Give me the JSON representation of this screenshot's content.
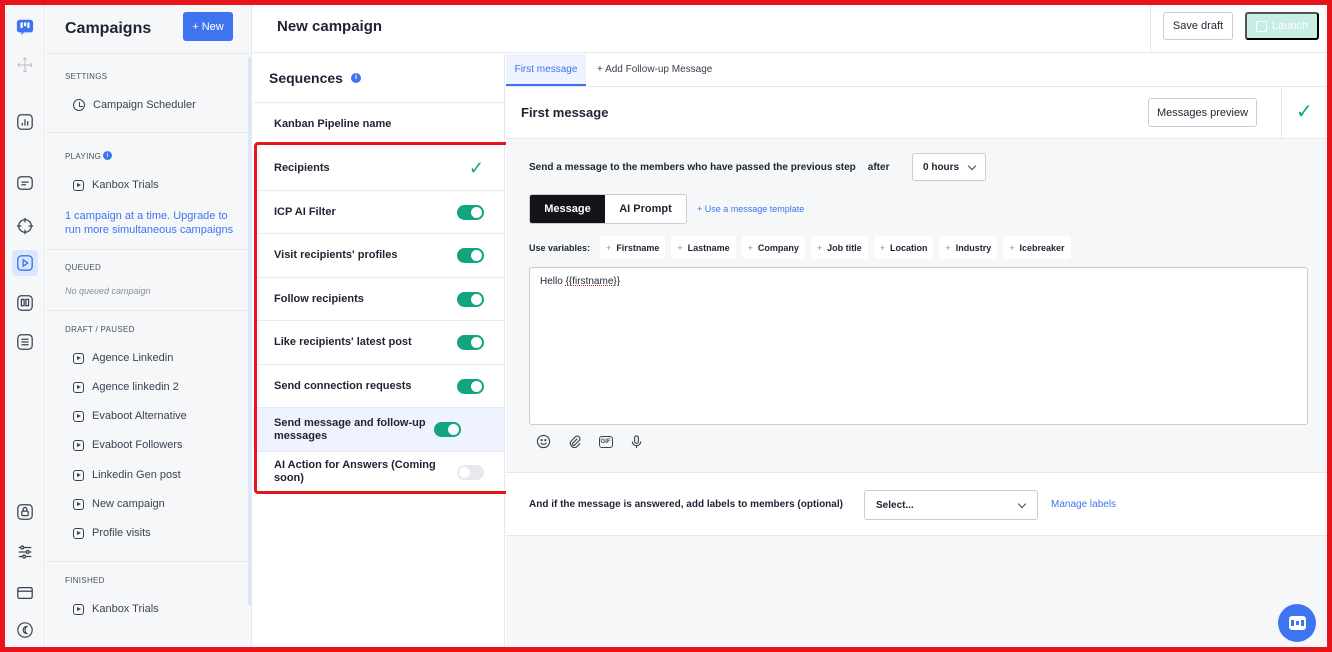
{
  "sidebar": {
    "title": "Campaigns",
    "new_button": "+ New",
    "sections": {
      "settings": "SETTINGS",
      "playing": "PLAYING",
      "queued": "QUEUED",
      "draft": "DRAFT / PAUSED",
      "finished": "FINISHED"
    },
    "scheduler": "Campaign Scheduler",
    "playing_items": [
      "Kanbox Trials"
    ],
    "upgrade_text": "1 campaign at a time. Upgrade to run more simultaneous campaigns",
    "queued_empty": "No queued campaign",
    "draft_items": [
      "Agence Linkedin",
      "Agence linkedin 2",
      "Evaboot Alternative",
      "Evaboot Followers",
      "Linkedin Gen post",
      "New campaign",
      "Profile visits"
    ],
    "finished_items": [
      "Kanbox Trials"
    ]
  },
  "header": {
    "title": "New campaign",
    "save_draft": "Save draft",
    "launch": "Launch"
  },
  "sequences": {
    "title": "Sequences",
    "pipeline": "Kanban Pipeline name",
    "rows": [
      {
        "label": "Recipients",
        "state": "check"
      },
      {
        "label": "ICP AI Filter",
        "state": "on"
      },
      {
        "label": "Visit recipients' profiles",
        "state": "on"
      },
      {
        "label": "Follow recipients",
        "state": "on"
      },
      {
        "label": "Like recipients' latest post",
        "state": "on"
      },
      {
        "label": "Send connection requests",
        "state": "on"
      },
      {
        "label": "Send message and follow-up messages",
        "state": "on",
        "selected": true
      },
      {
        "label": "AI Action for Answers (Coming soon)",
        "state": "off"
      }
    ]
  },
  "tabs": {
    "first": "First message",
    "add": "+ Add Follow-up Message"
  },
  "message": {
    "title": "First message",
    "preview_button": "Messages preview",
    "send_text": "Send a message to the members who have passed the previous step",
    "after": "after",
    "delay": "0 hours",
    "mode_message": "Message",
    "mode_ai": "AI Prompt",
    "template_link": "+ Use a message template",
    "variables_label": "Use variables:",
    "variables": [
      "Firstname",
      "Lastname",
      "Company",
      "Job title",
      "Location",
      "Industry",
      "Icebreaker"
    ],
    "body_prefix": "Hello ",
    "body_var": "{{firstname}}",
    "labels_text": "And if the message is answered, add labels to members (optional)",
    "labels_select": "Select...",
    "manage_labels": "Manage labels"
  },
  "colors": {
    "accent": "#3f74f0",
    "toggle_on": "#12a37f",
    "highlight": "#e8141b"
  }
}
